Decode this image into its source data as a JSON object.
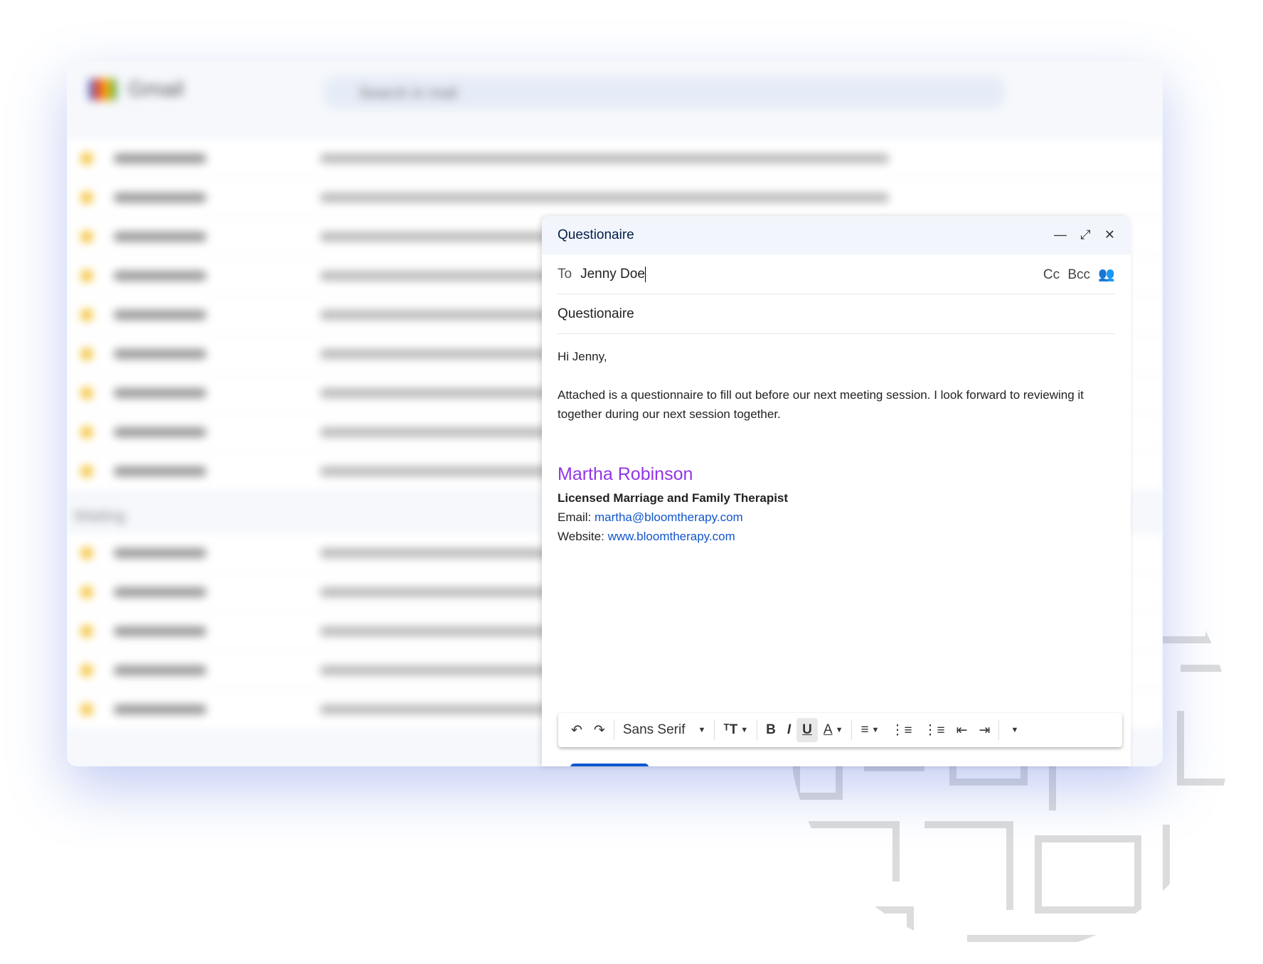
{
  "background_app": {
    "name": "Gmail",
    "search_placeholder": "Search in mail",
    "section_label": "Waiting"
  },
  "compose": {
    "title": "Questionaire",
    "to_label": "To",
    "to_value": "Jenny Doe",
    "cc": "Cc",
    "bcc": "Bcc",
    "subject": "Questionaire",
    "greeting": "Hi Jenny,",
    "paragraph": "Attached is a questionnaire to fill out before our next meeting session. I look forward to reviewing it together during our next session together.",
    "signature": {
      "name": "Martha Robinson",
      "title": "Licensed Marriage and Family Therapist",
      "email_label": "Email:",
      "email": "martha@bloomtherapy.com",
      "website_label": "Website:",
      "website": "www.bloomtherapy.com",
      "name_color": "#9334e6"
    },
    "toolbar": {
      "font": "Sans Serif"
    }
  }
}
